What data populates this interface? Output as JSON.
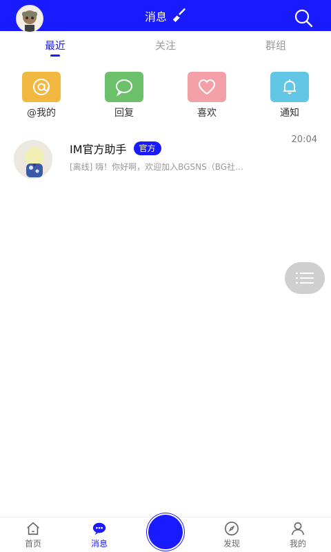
{
  "header": {
    "title": "消息",
    "avatar_icon": "user-avatar",
    "broom_icon": "broom-icon",
    "search_icon": "search-icon"
  },
  "tabs": [
    {
      "label": "最近",
      "active": true
    },
    {
      "label": "关注",
      "active": false
    },
    {
      "label": "群组",
      "active": false
    }
  ],
  "quick": [
    {
      "label": "@我的",
      "icon": "at-icon",
      "color": "#f1b942"
    },
    {
      "label": "回复",
      "icon": "chat-icon",
      "color": "#6cc06a"
    },
    {
      "label": "喜欢",
      "icon": "heart-icon",
      "color": "#f3a0a6"
    },
    {
      "label": "通知",
      "icon": "bell-icon",
      "color": "#62c6e5"
    }
  ],
  "conversation": {
    "name": "IM官方助手",
    "badge": "官方",
    "time": "20:04",
    "preview": "[离线] 嗨！你好啊，欢迎加入BGSNS（BG社…"
  },
  "bottom_nav": [
    {
      "label": "首页",
      "icon": "home-icon",
      "active": false
    },
    {
      "label": "消息",
      "icon": "message-icon",
      "active": true
    },
    {
      "label": "",
      "icon": "center-action",
      "active": false
    },
    {
      "label": "发现",
      "icon": "compass-icon",
      "active": false
    },
    {
      "label": "我的",
      "icon": "profile-icon",
      "active": false
    }
  ],
  "colors": {
    "primary": "#1a1aff",
    "muted": "#999999",
    "fab": "#cfcfcf"
  }
}
